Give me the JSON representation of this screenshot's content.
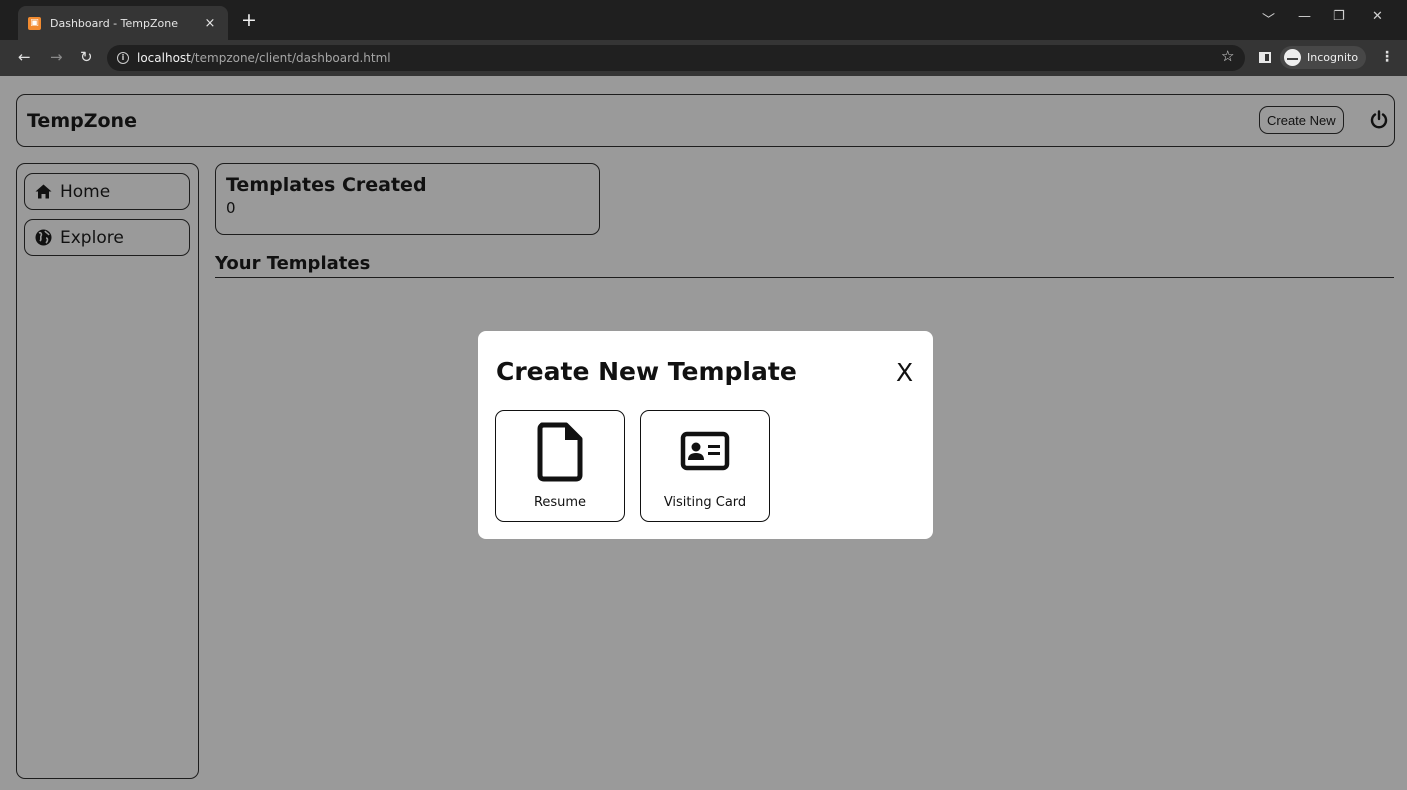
{
  "browser": {
    "tab_title": "Dashboard - TempZone",
    "tab_close": "×",
    "new_tab": "+",
    "url_host": "localhost",
    "url_path": "/tempzone/client/dashboard.html",
    "incognito_label": "Incognito"
  },
  "header": {
    "brand": "TempZone",
    "create_new_label": "Create New"
  },
  "sidebar": {
    "items": [
      {
        "label": "Home",
        "icon": "home-icon"
      },
      {
        "label": "Explore",
        "icon": "globe-icon"
      }
    ]
  },
  "stats": {
    "title": "Templates Created",
    "value": "0"
  },
  "templates_section": {
    "title": "Your Templates"
  },
  "modal": {
    "title": "Create New Template",
    "close_label": "X",
    "options": [
      {
        "label": "Resume",
        "icon": "file-icon"
      },
      {
        "label": "Visiting Card",
        "icon": "id-card-icon"
      }
    ]
  }
}
